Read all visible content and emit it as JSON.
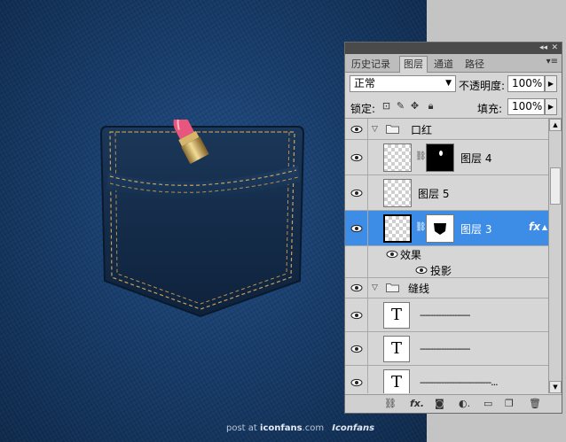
{
  "canvas": {
    "watermark_prefix": "post at",
    "watermark_site": "iconfans",
    "watermark_suffix": ".com",
    "watermark_logo": "Iconfans"
  },
  "panel": {
    "tabs": [
      "历史记录",
      "图层",
      "通道",
      "路径"
    ],
    "active_tab": "图层",
    "blend_mode": "正常",
    "opacity_label": "不透明度:",
    "opacity_value": "100%",
    "lock_label": "锁定:",
    "fill_label": "填充:",
    "fill_value": "100%",
    "layers": {
      "group_lipstick": "口红",
      "layer4": "图层 4",
      "layer5": "图层 5",
      "layer3": "图层 3",
      "effects": "效果",
      "drop_shadow": "投影",
      "group_stitch": "缝线",
      "text1": "-------------------",
      "text2": "-------------------",
      "text3": "---------------------------..."
    },
    "fx_label": "fx"
  },
  "colors": {
    "selection": "#3d8de6",
    "denim": "#183d6b",
    "lipstick": "#e8557d"
  }
}
